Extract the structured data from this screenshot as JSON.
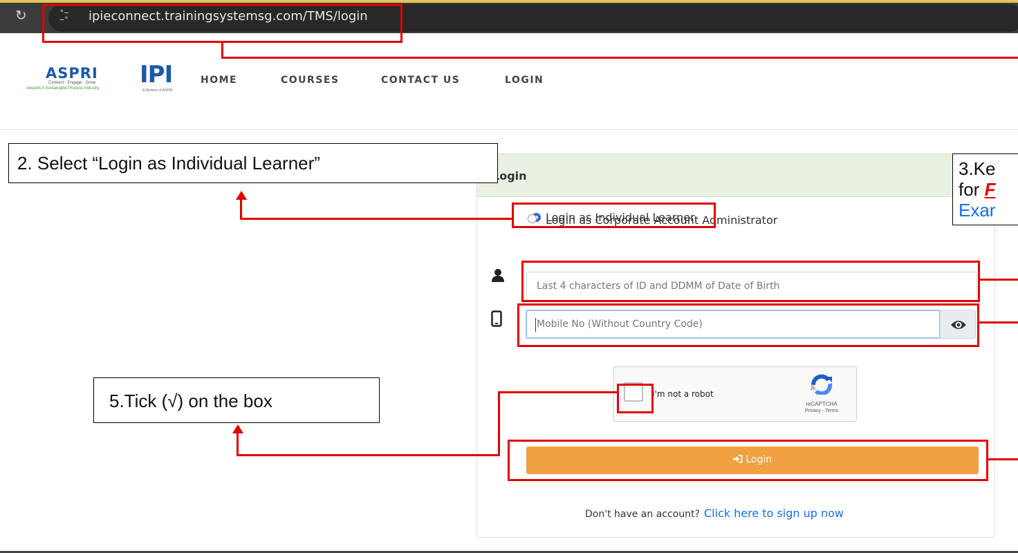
{
  "browser": {
    "url": "ipieconnect.trainingsystemsg.com/TMS/login"
  },
  "header": {
    "logo_aspri": {
      "name": "ASPRI",
      "tagline": "Connect - Engage - Grow",
      "subtagline": "towards A Sustainable Process Industry"
    },
    "logo_ipi": {
      "name": "IPI",
      "tagline": "A Division of ASPRI"
    },
    "nav": [
      "HOME",
      "COURSES",
      "CONTACT US",
      "LOGIN"
    ]
  },
  "login_panel": {
    "title": "Login",
    "radio_options": [
      {
        "label": "Login as Individual Learner",
        "selected": true
      },
      {
        "label": "Login as Corporate Account Administrator",
        "selected": false
      }
    ],
    "username_placeholder": "Last 4 characters of ID and DDMM of Date of Birth",
    "mobile_placeholder": "Mobile No (Without Country Code)",
    "captcha": {
      "label": "I'm not a robot",
      "brand": "reCAPTCHA",
      "links": "Privacy - Terms"
    },
    "login_button": "Login",
    "signup_text": "Don't have an account?",
    "signup_link": "Click here to sign up now"
  },
  "annotations": {
    "step2": "2. Select “Login as Individual Learner”",
    "step3_line1": "3.Ke",
    "step3_line2_prefix": "for ",
    "step3_line2_em": "F",
    "step3_line3": "Exar",
    "step5": "5.Tick (√) on the box"
  },
  "colors": {
    "annotation_red": "#e00000",
    "login_button": "#f0a040",
    "panel_header": "#e9f2e2",
    "link_blue": "#1a6ce6",
    "brand_blue": "#1a5aa8"
  }
}
